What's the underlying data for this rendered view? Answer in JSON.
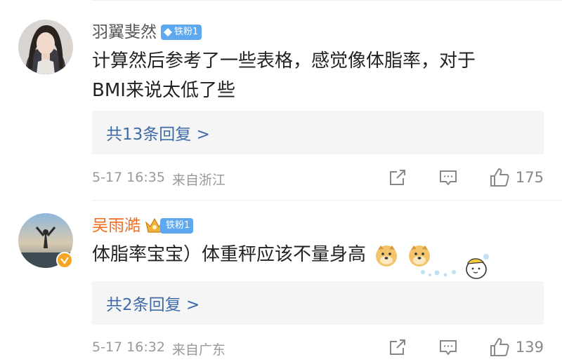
{
  "comments": [
    {
      "username": "羽翼斐然",
      "badge": "铁粉1",
      "text_line1": "计算然后参考了一些表格，感觉像体脂率，对于",
      "text_line2": "BMI来说太低了些",
      "replies_label": "共13条回复 >",
      "timestamp": "5-17 16:35",
      "location": "来自浙江",
      "like_count": "175"
    },
    {
      "username": "吴雨澔",
      "badge": "铁粉1",
      "text": "体脂率宝宝）体重秤应该不量身高",
      "replies_label": "共2条回复 >",
      "timestamp": "5-17 16:32",
      "location": "来自广东",
      "like_count": "139"
    }
  ],
  "colors": {
    "link": "#3e6ba8",
    "username_highlight": "#f26b1d",
    "badge_blue": "#5ea8f0",
    "muted": "#999999"
  },
  "icons": [
    "share-icon",
    "comment-icon",
    "like-icon",
    "diamond-icon",
    "crown-icon",
    "verified-icon",
    "doge-emoji"
  ]
}
